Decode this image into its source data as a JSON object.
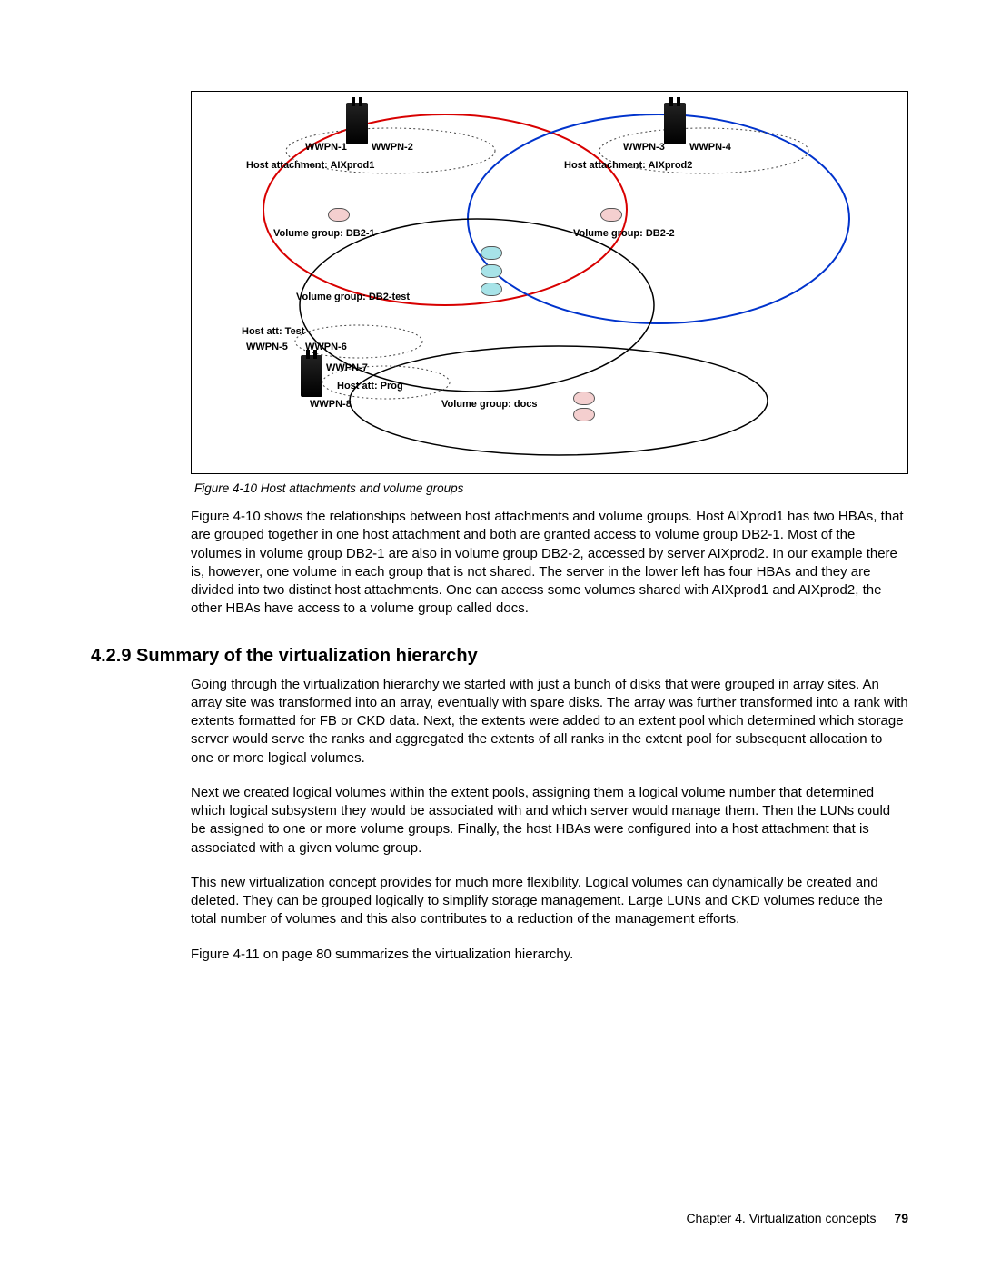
{
  "figure": {
    "caption": "Figure 4-10   Host attachments and volume groups",
    "labels": {
      "wwpn1": "WWPN-1",
      "wwpn2": "WWPN-2",
      "wwpn3": "WWPN-3",
      "wwpn4": "WWPN-4",
      "wwpn5": "WWPN-5",
      "wwpn6": "WWPN-6",
      "wwpn7": "WWPN-7",
      "wwpn8": "WWPN-8",
      "host_aix1": "Host attachment: AIXprod1",
      "host_aix2": "Host attachment: AIXprod2",
      "vg_db2_1": "Volume group: DB2-1",
      "vg_db2_2": "Volume group: DB2-2",
      "vg_db2_test": "Volume group: DB2-test",
      "host_test": "Host att: Test",
      "host_prog": "Host att: Prog",
      "vg_docs": "Volume group: docs"
    }
  },
  "para1": "Figure 4-10 shows the relationships between host attachments and volume groups. Host AIXprod1 has two HBAs, that are grouped together in one host attachment and both are granted access to volume group DB2-1. Most of the volumes in volume group DB2-1 are also in volume group DB2-2, accessed by server AIXprod2. In our example there is, however, one volume in each group that is not shared. The server in the lower left has four HBAs and they are divided into two distinct host attachments. One can access some volumes shared with AIXprod1 and AIXprod2, the other HBAs have access to a volume group called docs.",
  "heading": "4.2.9  Summary of the virtualization hierarchy",
  "para2": "Going through the virtualization hierarchy we started with just a bunch of disks that were grouped in array sites. An array site was transformed into an array, eventually with spare disks. The array was further transformed into a rank with extents formatted for FB or CKD data. Next, the extents were added to an extent pool which determined which storage server would serve the ranks and aggregated the extents of all ranks in the extent pool for subsequent allocation to one or more logical volumes.",
  "para3": "Next we created logical volumes within the extent pools, assigning them a logical volume number that determined which logical subsystem they would be associated with and which server would manage them. Then the LUNs could be assigned to one or more volume groups. Finally, the host HBAs were configured into a host attachment that is associated with a given volume group.",
  "para4": "This new virtualization concept provides for much more flexibility. Logical volumes can dynamically be created and deleted. They can be grouped logically to simplify storage management. Large LUNs and CKD volumes reduce the total number of volumes and this also contributes to a reduction of the management efforts.",
  "para5": "Figure 4-11 on page 80 summarizes the virtualization hierarchy.",
  "footer": {
    "chapter": "Chapter 4. Virtualization concepts",
    "page": "79"
  }
}
